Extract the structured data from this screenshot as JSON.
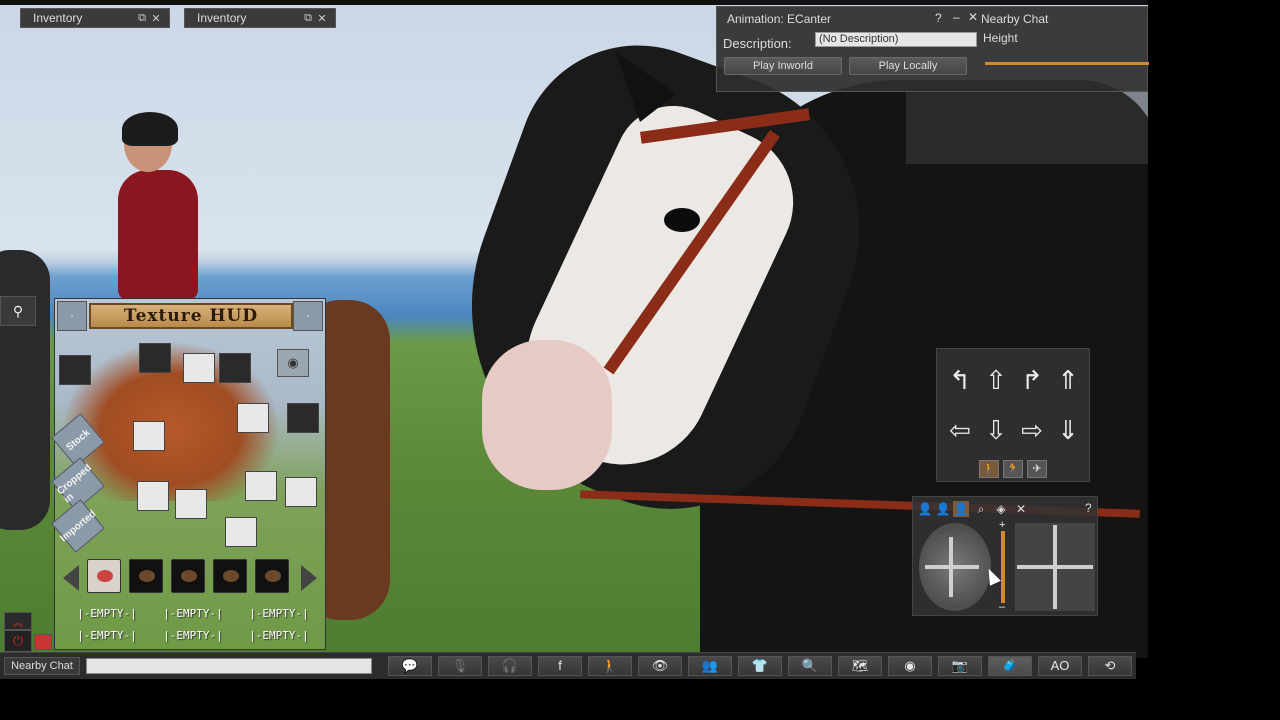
{
  "colors": {
    "accent": "#d58a2a",
    "panel_bg": "#2e2e2e",
    "hud_title_bg": "#c9a06a"
  },
  "inventory_tabs": [
    {
      "label": "Inventory"
    },
    {
      "label": "Inventory"
    }
  ],
  "animation_panel": {
    "title": "Animation: ECanter",
    "help": "?",
    "minimize": "–",
    "close": "✕",
    "description_label": "Description:",
    "description_value": "(No Description)",
    "play_inworld": "Play Inworld",
    "play_locally": "Play Locally"
  },
  "nearby_chat_panel": {
    "title": "Nearby Chat",
    "partial_label": "Height"
  },
  "texture_hud": {
    "title": "Texture HUD",
    "side_buttons": [
      "Stock",
      "Cropped in",
      "Imported"
    ],
    "empty_slots": [
      "|-EMPTY-|",
      "|-EMPTY-|",
      "|-EMPTY-|",
      "|-EMPTY-|",
      "|-EMPTY-|",
      "|-EMPTY-|"
    ]
  },
  "camera_panel": {
    "help": "?"
  },
  "bottom_bar": {
    "chat_label": "Nearby Chat",
    "chat_placeholder": "",
    "buttons": [
      {
        "name": "chat-button",
        "icon": "speech-bubble-icon",
        "glyph": "💬"
      },
      {
        "name": "voice-button",
        "icon": "microphone-icon",
        "glyph": "🎙"
      },
      {
        "name": "headset-button",
        "icon": "headphones-icon",
        "glyph": "🎧"
      },
      {
        "name": "facebook-button",
        "icon": "facebook-icon",
        "glyph": "f"
      },
      {
        "name": "move-button",
        "icon": "walking-person-icon",
        "glyph": "🚶"
      },
      {
        "name": "view-button",
        "icon": "eye-icon",
        "glyph": "👁"
      },
      {
        "name": "people-button",
        "icon": "people-icon",
        "glyph": "👥"
      },
      {
        "name": "appearance-button",
        "icon": "shirt-icon",
        "glyph": "👕"
      },
      {
        "name": "search-button",
        "icon": "search-icon",
        "glyph": "🔍"
      },
      {
        "name": "map-button",
        "icon": "map-icon",
        "glyph": "🗺"
      },
      {
        "name": "radar-button",
        "icon": "radar-icon",
        "glyph": "◉"
      },
      {
        "name": "snapshot-button",
        "icon": "camera-icon",
        "glyph": "📷"
      },
      {
        "name": "inventory-button",
        "icon": "suitcase-icon",
        "glyph": "🧳"
      },
      {
        "name": "ao-button",
        "icon": "ao-icon",
        "glyph": "AO"
      },
      {
        "name": "sync-button",
        "icon": "sync-icon",
        "glyph": "⟲"
      }
    ]
  }
}
